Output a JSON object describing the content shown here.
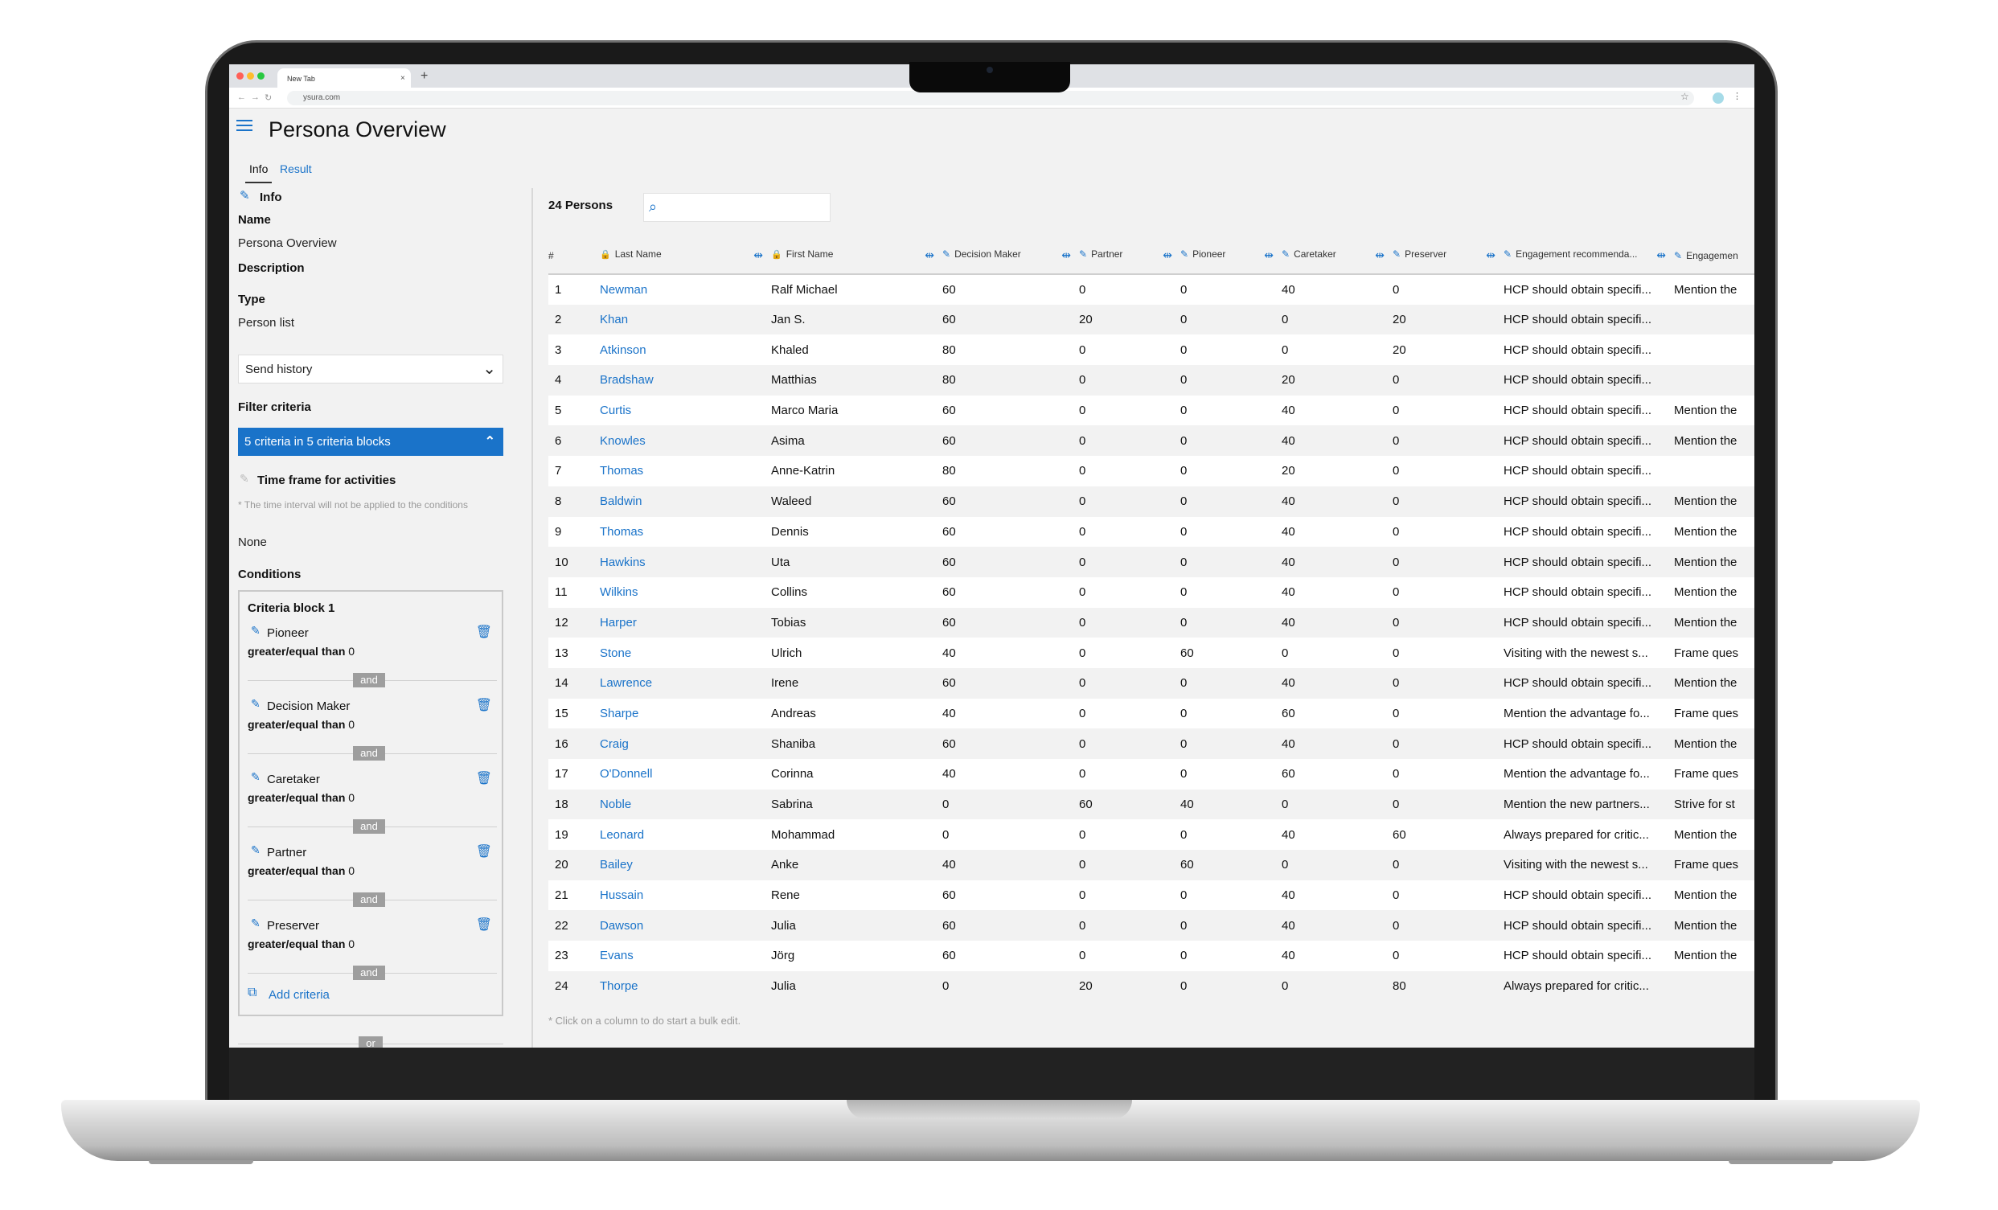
{
  "browser": {
    "tab_title": "New Tab",
    "tab_close": "×",
    "new_tab": "+",
    "url": "ysura.com",
    "star": "☆",
    "menu": "⋮",
    "traffic_lights": [
      "#ff5f57",
      "#febc2e",
      "#28c840"
    ]
  },
  "app": {
    "title": "Persona Overview",
    "accent_color": "#1a73c9",
    "tabs": [
      {
        "label": "Info",
        "active": true
      },
      {
        "label": "Result",
        "active": false
      }
    ]
  },
  "info_panel": {
    "heading": "Info",
    "name_label": "Name",
    "name_value": "Persona Overview",
    "description_label": "Description",
    "type_label": "Type",
    "type_value": "Person list",
    "send_history": "Send history",
    "filter_criteria_label": "Filter criteria",
    "criteria_summary": "5 criteria in 5 criteria blocks",
    "time_frame_label": "Time frame for activities",
    "time_frame_note": "* The time interval will not be applied to the conditions",
    "time_frame_value": "None",
    "conditions_label": "Conditions",
    "criteria_block_title": "Criteria block 1",
    "criteria": [
      {
        "name": "Pioneer",
        "operator": "greater/equal than",
        "value": "0",
        "joiner": "and"
      },
      {
        "name": "Decision Maker",
        "operator": "greater/equal than",
        "value": "0",
        "joiner": "and"
      },
      {
        "name": "Caretaker",
        "operator": "greater/equal than",
        "value": "0",
        "joiner": "and"
      },
      {
        "name": "Partner",
        "operator": "greater/equal than",
        "value": "0",
        "joiner": "and"
      },
      {
        "name": "Preserver",
        "operator": "greater/equal than",
        "value": "0",
        "joiner": "and"
      }
    ],
    "add_criteria": "Add criteria",
    "block_joiner": "or"
  },
  "results": {
    "count_label": "24 Persons",
    "search_placeholder": "",
    "columns": [
      "#",
      "Last Name",
      "First Name",
      "Decision Maker",
      "Partner",
      "Pioneer",
      "Caretaker",
      "Preserver",
      "Engagement recommenda...",
      "Engagemen"
    ],
    "rows": [
      [
        "1",
        "Newman",
        "Ralf Michael",
        "60",
        "0",
        "0",
        "40",
        "0",
        "HCP should obtain specifi...",
        "Mention the"
      ],
      [
        "2",
        "Khan",
        "Jan S.",
        "60",
        "20",
        "0",
        "0",
        "20",
        "HCP should obtain specifi...",
        ""
      ],
      [
        "3",
        "Atkinson",
        "Khaled",
        "80",
        "0",
        "0",
        "0",
        "20",
        "HCP should obtain specifi...",
        ""
      ],
      [
        "4",
        "Bradshaw",
        "Matthias",
        "80",
        "0",
        "0",
        "20",
        "0",
        "HCP should obtain specifi...",
        ""
      ],
      [
        "5",
        "Curtis",
        "Marco Maria",
        "60",
        "0",
        "0",
        "40",
        "0",
        "HCP should obtain specifi...",
        "Mention the"
      ],
      [
        "6",
        "Knowles",
        "Asima",
        "60",
        "0",
        "0",
        "40",
        "0",
        "HCP should obtain specifi...",
        "Mention the"
      ],
      [
        "7",
        "Thomas",
        "Anne-Katrin",
        "80",
        "0",
        "0",
        "20",
        "0",
        "HCP should obtain specifi...",
        ""
      ],
      [
        "8",
        "Baldwin",
        "Waleed",
        "60",
        "0",
        "0",
        "40",
        "0",
        "HCP should obtain specifi...",
        "Mention the"
      ],
      [
        "9",
        "Thomas",
        "Dennis",
        "60",
        "0",
        "0",
        "40",
        "0",
        "HCP should obtain specifi...",
        "Mention the"
      ],
      [
        "10",
        "Hawkins",
        "Uta",
        "60",
        "0",
        "0",
        "40",
        "0",
        "HCP should obtain specifi...",
        "Mention the"
      ],
      [
        "11",
        "Wilkins",
        "Collins",
        "60",
        "0",
        "0",
        "40",
        "0",
        "HCP should obtain specifi...",
        "Mention the"
      ],
      [
        "12",
        "Harper",
        "Tobias",
        "60",
        "0",
        "0",
        "40",
        "0",
        "HCP should obtain specifi...",
        "Mention the"
      ],
      [
        "13",
        "Stone",
        "Ulrich",
        "40",
        "0",
        "60",
        "0",
        "0",
        "Visiting with the newest s...",
        "Frame ques"
      ],
      [
        "14",
        "Lawrence",
        "Irene",
        "60",
        "0",
        "0",
        "40",
        "0",
        "HCP should obtain specifi...",
        "Mention the"
      ],
      [
        "15",
        "Sharpe",
        "Andreas",
        "40",
        "0",
        "0",
        "60",
        "0",
        "Mention the advantage fo...",
        "Frame ques"
      ],
      [
        "16",
        "Craig",
        "Shaniba",
        "60",
        "0",
        "0",
        "40",
        "0",
        "HCP should obtain specifi...",
        "Mention the"
      ],
      [
        "17",
        "O'Donnell",
        "Corinna",
        "40",
        "0",
        "0",
        "60",
        "0",
        "Mention the advantage fo...",
        "Frame ques"
      ],
      [
        "18",
        "Noble",
        "Sabrina",
        "0",
        "60",
        "40",
        "0",
        "0",
        "Mention the new partners...",
        "Strive for st"
      ],
      [
        "19",
        "Leonard",
        "Mohammad",
        "0",
        "0",
        "0",
        "40",
        "60",
        "Always prepared for critic...",
        "Mention the"
      ],
      [
        "20",
        "Bailey",
        "Anke",
        "40",
        "0",
        "60",
        "0",
        "0",
        "Visiting with the newest s...",
        "Frame ques"
      ],
      [
        "21",
        "Hussain",
        "Rene",
        "60",
        "0",
        "0",
        "40",
        "0",
        "HCP should obtain specifi...",
        "Mention the"
      ],
      [
        "22",
        "Dawson",
        "Julia",
        "60",
        "0",
        "0",
        "40",
        "0",
        "HCP should obtain specifi...",
        "Mention the"
      ],
      [
        "23",
        "Evans",
        "Jörg",
        "60",
        "0",
        "0",
        "40",
        "0",
        "HCP should obtain specifi...",
        "Mention the"
      ],
      [
        "24",
        "Thorpe",
        "Julia",
        "0",
        "20",
        "0",
        "0",
        "80",
        "Always prepared for critic...",
        ""
      ]
    ],
    "footnote": "* Click on a column to do start a bulk edit."
  },
  "icons": {
    "menu": "hamburger-icon",
    "edit": "pencil-icon",
    "delete": "trash-icon",
    "add": "add-criteria-icon",
    "search": "search-icon",
    "lock": "lock-icon",
    "resize": "column-resize-icon",
    "chevron_down": "chevron-down-icon",
    "chevron_up": "chevron-up-icon"
  }
}
